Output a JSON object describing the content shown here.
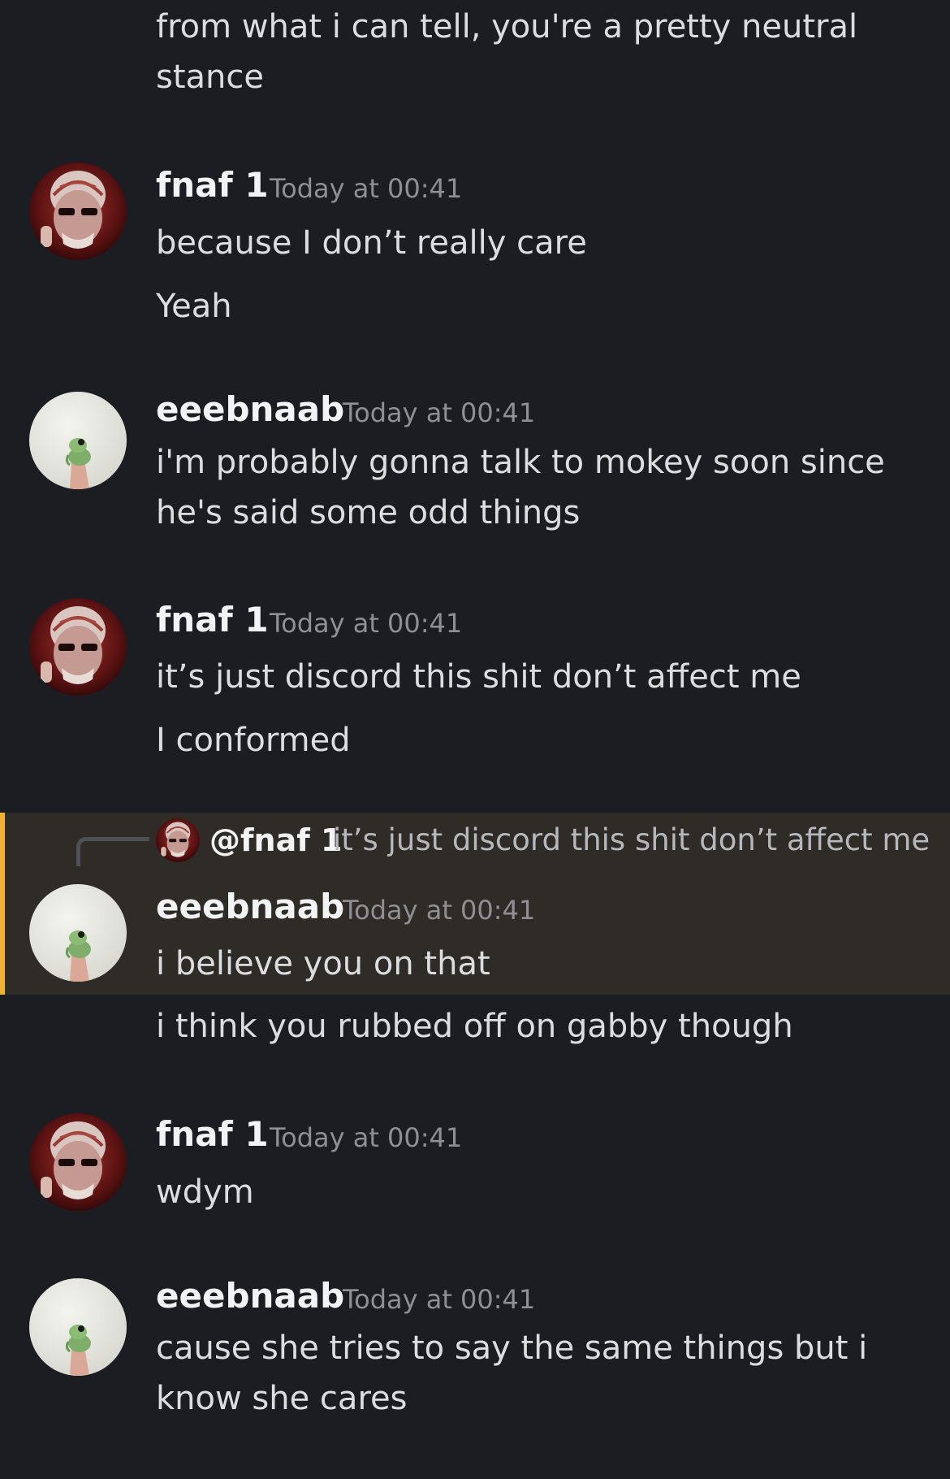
{
  "colors": {
    "background": "#1c1d23",
    "highlight_background": "#2f2b27",
    "highlight_accent": "#f0b232",
    "username": "#f2f3f5",
    "timestamp": "#8e9096",
    "message_text": "#dbdee1"
  },
  "messages": [
    {
      "continuation": [
        "from what i can tell, you're a pretty neutral stance"
      ]
    },
    {
      "author": "fnaf 1",
      "avatar": "fnaf-avatar",
      "timestamp": "Today at 00:41",
      "lines": [
        "because I don’t really care",
        "Yeah"
      ]
    },
    {
      "author": "eeebnaab",
      "avatar": "frog-avatar",
      "timestamp": "Today at 00:41",
      "lines": [
        "i'm probably gonna talk to mokey soon since he's said some odd things"
      ]
    },
    {
      "author": "fnaf 1",
      "avatar": "fnaf-avatar",
      "timestamp": "Today at 00:41",
      "lines": [
        "it’s just discord this shit don’t affect me",
        "I conformed"
      ]
    },
    {
      "reply": {
        "mention": "@fnaf 1",
        "text": "it’s just discord this shit don’t affect me"
      },
      "author": "eeebnaab",
      "avatar": "frog-avatar",
      "timestamp": "Today at 00:41",
      "lines": [
        "i believe you on that",
        "i think you rubbed off on gabby though"
      ]
    },
    {
      "author": "fnaf 1",
      "avatar": "fnaf-avatar",
      "timestamp": "Today at 00:41",
      "lines": [
        "wdym"
      ]
    },
    {
      "author": "eeebnaab",
      "avatar": "frog-avatar",
      "timestamp": "Today at 00:41",
      "lines": [
        "cause she tries to say the same things but i know she cares"
      ]
    }
  ]
}
